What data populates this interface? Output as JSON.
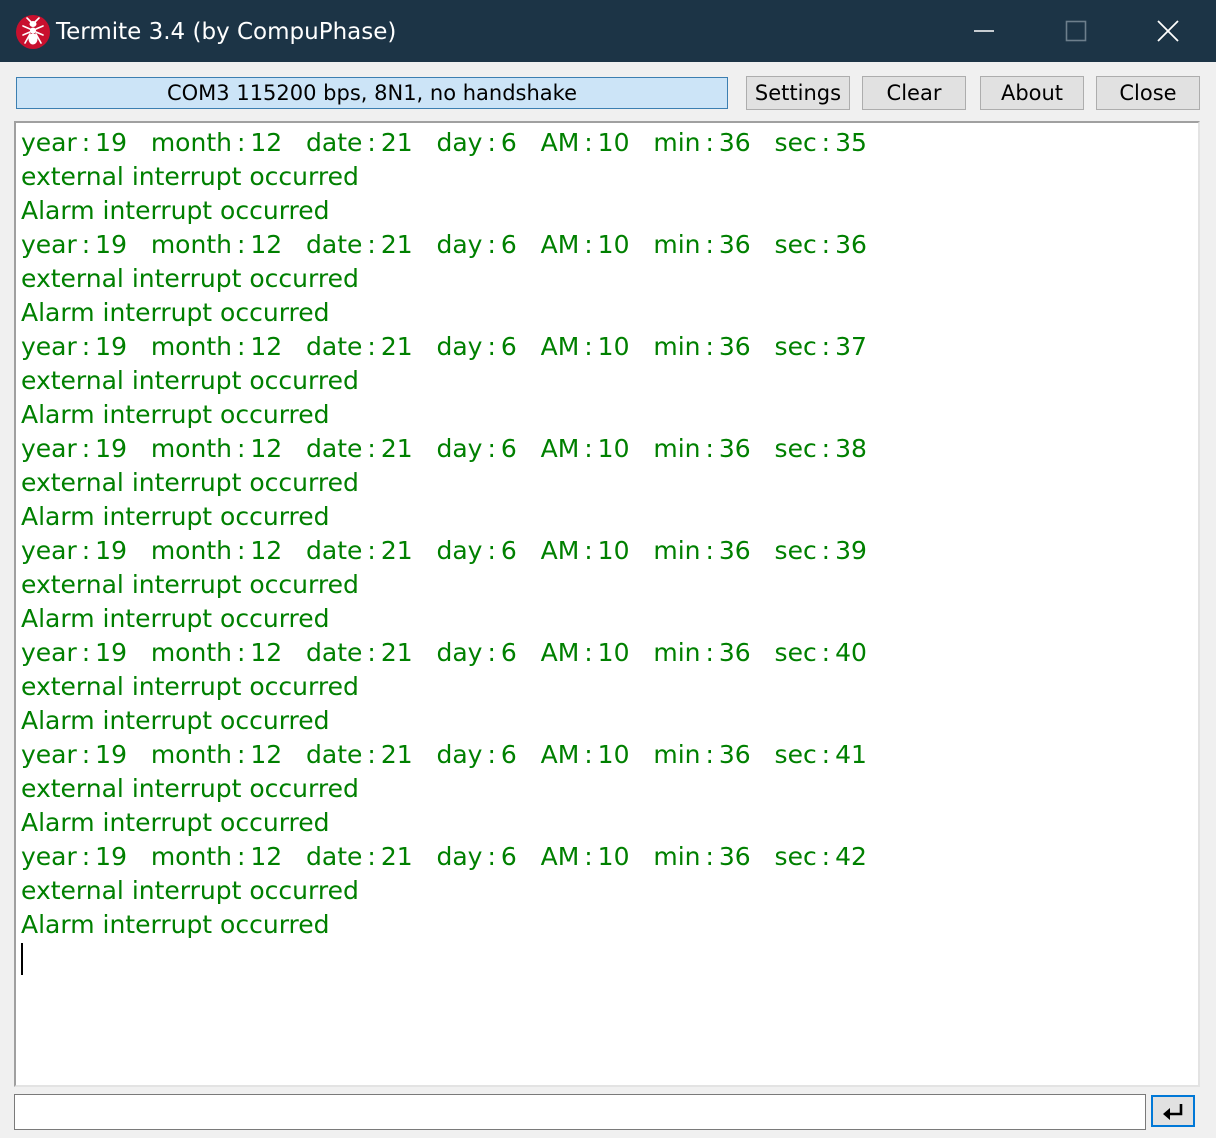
{
  "window": {
    "title": "Termite 3.4 (by CompuPhase)",
    "icon": "ant-icon",
    "controls": [
      "minimize-icon",
      "maximize-icon",
      "close-icon"
    ]
  },
  "toolbar": {
    "status": "COM3 115200 bps, 8N1, no handshake",
    "settings_label": "Settings",
    "clear_label": "Clear",
    "about_label": "About",
    "close_label": "Close"
  },
  "terminal": {
    "lines": [
      "year : 19   month : 12   date : 21   day : 6   AM : 10   min : 36   sec : 35",
      "external interrupt occurred",
      "Alarm interrupt occurred",
      "year : 19   month : 12   date : 21   day : 6   AM : 10   min : 36   sec : 36",
      "external interrupt occurred",
      "Alarm interrupt occurred",
      "year : 19   month : 12   date : 21   day : 6   AM : 10   min : 36   sec : 37",
      "external interrupt occurred",
      "Alarm interrupt occurred",
      "year : 19   month : 12   date : 21   day : 6   AM : 10   min : 36   sec : 38",
      "external interrupt occurred",
      "Alarm interrupt occurred",
      "year : 19   month : 12   date : 21   day : 6   AM : 10   min : 36   sec : 39",
      "external interrupt occurred",
      "Alarm interrupt occurred",
      "year : 19   month : 12   date : 21   day : 6   AM : 10   min : 36   sec : 40",
      "external interrupt occurred",
      "Alarm interrupt occurred",
      "year : 19   month : 12   date : 21   day : 6   AM : 10   min : 36   sec : 41",
      "external interrupt occurred",
      "Alarm interrupt occurred",
      "year : 19   month : 12   date : 21   day : 6   AM : 10   min : 36   sec : 42",
      "external interrupt occurred",
      "Alarm interrupt occurred"
    ],
    "text_color": "#008000"
  },
  "input": {
    "value": "",
    "send_icon": "enter-return-icon"
  },
  "colors": {
    "titlebar": "#1c3446",
    "status_field": "#cce4f7",
    "focus_border": "#0078d7"
  }
}
